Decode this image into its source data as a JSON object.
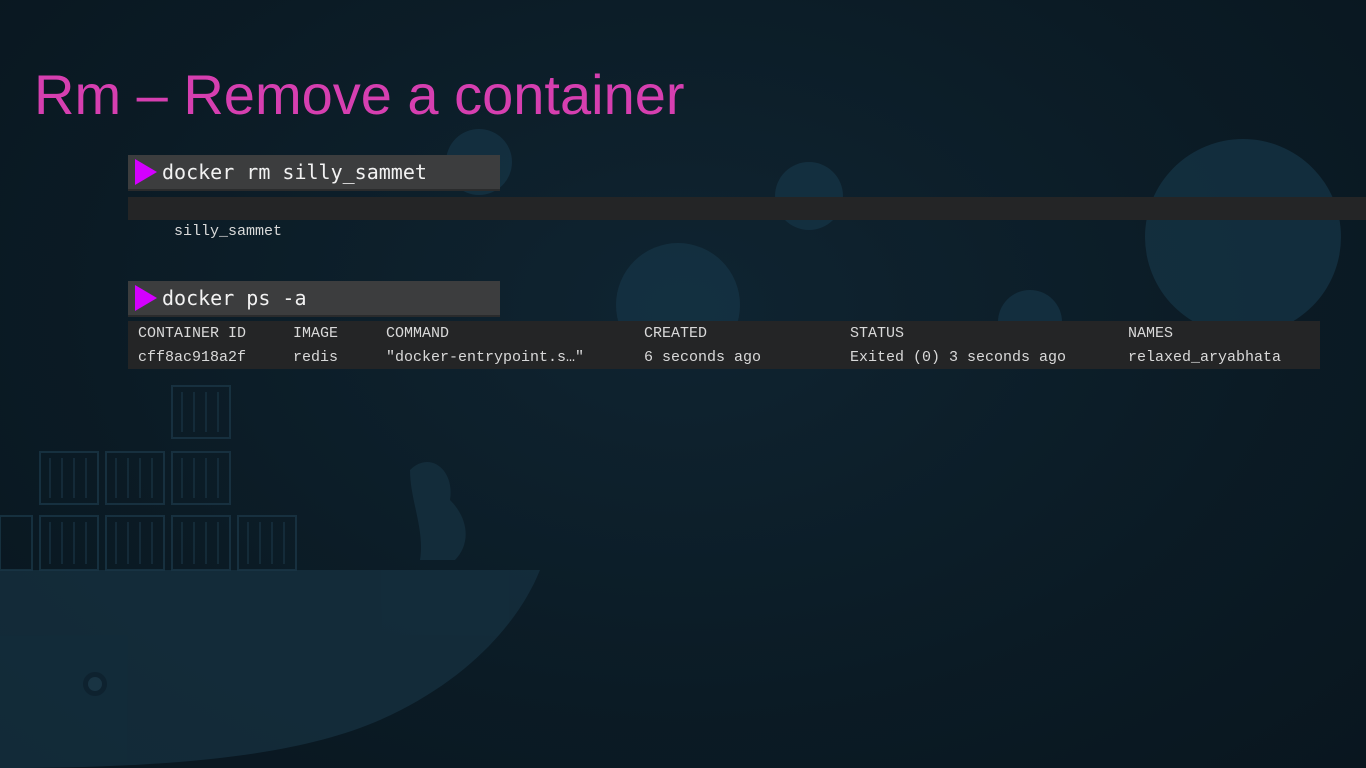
{
  "slide": {
    "title": "Rm – Remove a container"
  },
  "commands": [
    {
      "prompt_icon": "play-triangle-icon",
      "command": "docker rm silly_sammet",
      "output": "silly_sammet"
    },
    {
      "prompt_icon": "play-triangle-icon",
      "command": "docker ps -a"
    }
  ],
  "ps_table": {
    "headers": [
      "CONTAINER ID",
      "IMAGE",
      "COMMAND",
      "CREATED",
      "STATUS",
      "NAMES"
    ],
    "rows": [
      [
        "cff8ac918a2f",
        "redis",
        "\"docker-entrypoint.s…\"",
        "6 seconds ago",
        "Exited (0) 3 seconds ago",
        "relaxed_aryabhata"
      ]
    ]
  },
  "colors": {
    "background": "#0c1c27",
    "title": "#d63fb0",
    "prompt_icon": "#d400ff",
    "command_bar": "#3c3d3e",
    "output_bar": "#242526"
  }
}
